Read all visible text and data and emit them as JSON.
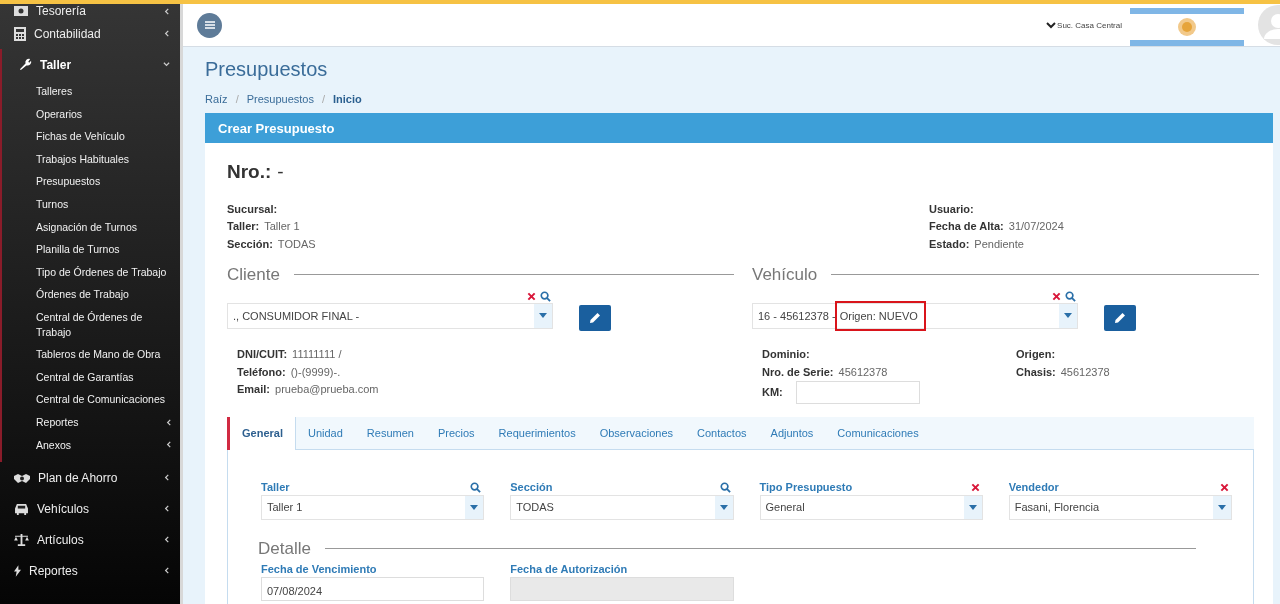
{
  "sidebar": {
    "items": [
      {
        "label": "Tesorería",
        "expanded": false
      },
      {
        "label": "Contabilidad",
        "expanded": false
      },
      {
        "label": "Taller",
        "expanded": true,
        "children": [
          {
            "label": "Talleres",
            "submenu": false
          },
          {
            "label": "Operarios",
            "submenu": false
          },
          {
            "label": "Fichas de Vehículo",
            "submenu": false
          },
          {
            "label": "Trabajos Habituales",
            "submenu": false
          },
          {
            "label": "Presupuestos",
            "submenu": false
          },
          {
            "label": "Turnos",
            "submenu": false
          },
          {
            "label": "Asignación de Turnos",
            "submenu": false
          },
          {
            "label": "Planilla de Turnos",
            "submenu": false
          },
          {
            "label": "Tipo de Órdenes de Trabajo",
            "submenu": false
          },
          {
            "label": "Órdenes de Trabajo",
            "submenu": false
          },
          {
            "label": "Central de Órdenes de Trabajo",
            "submenu": false
          },
          {
            "label": "Tableros de Mano de Obra",
            "submenu": false
          },
          {
            "label": "Central de Garantías",
            "submenu": false
          },
          {
            "label": "Central de Comunicaciones",
            "submenu": false
          },
          {
            "label": "Reportes",
            "submenu": true
          },
          {
            "label": "Anexos",
            "submenu": true
          }
        ]
      },
      {
        "label": "Plan de Ahorro",
        "expanded": false
      },
      {
        "label": "Vehículos",
        "expanded": false
      },
      {
        "label": "Artículos",
        "expanded": false
      },
      {
        "label": "Reportes",
        "expanded": false
      }
    ]
  },
  "header": {
    "branch": "Suc. Casa Central"
  },
  "page": {
    "title": "Presupuestos",
    "separator": "/",
    "breadcrumb": [
      {
        "label": "Raíz",
        "selected": false
      },
      {
        "label": "Presupuestos",
        "selected": false
      },
      {
        "label": "Inicio",
        "selected": true
      }
    ]
  },
  "panel": {
    "title": "Crear Presupuesto",
    "number_label": "Nro.:",
    "number": "-",
    "info_left": [
      {
        "label": "Sucursal:"
      },
      {
        "label": "Taller:",
        "value": "Taller 1"
      },
      {
        "label": "Sección:",
        "value": "TODAS"
      }
    ],
    "info_right": [
      {
        "label": "Usuario:"
      },
      {
        "label": "Fecha de Alta:",
        "value": "31/07/2024"
      },
      {
        "label": "Estado:",
        "value": "Pendiente"
      }
    ],
    "cliente": {
      "title": "Cliente",
      "select": [
        {
          "text": "., CONSUMIDOR FINAL -",
          "highlighted": false
        }
      ],
      "details": [
        {
          "label": "DNI/CUIT:",
          "value": "11111111 /"
        },
        {
          "label": "Teléfono:",
          "value": "()-(9999)-."
        },
        {
          "label": "Email:",
          "value": "prueba@prueba.com"
        }
      ]
    },
    "vehiculo": {
      "title": "Vehículo",
      "select": [
        {
          "text": "16 - 45612378 -",
          "highlighted": false
        },
        {
          "text": "Origen: NUEVO",
          "highlighted": true
        }
      ],
      "details_left": [
        {
          "label": "Dominio:"
        },
        {
          "label": "Nro. de Serie:",
          "value": "45612378"
        },
        {
          "label": "KM:",
          "kind": "input"
        }
      ],
      "details_right": [
        {
          "label": "Origen:"
        },
        {
          "label": "Chasis:",
          "value": "45612378"
        }
      ]
    },
    "tabs": [
      {
        "label": "General",
        "selected": true
      },
      {
        "label": "Unidad",
        "selected": false
      },
      {
        "label": "Resumen",
        "selected": false
      },
      {
        "label": "Precios",
        "selected": false
      },
      {
        "label": "Requerimientos",
        "selected": false
      },
      {
        "label": "Observaciones",
        "selected": false
      },
      {
        "label": "Contactos",
        "selected": false
      },
      {
        "label": "Adjuntos",
        "selected": false
      },
      {
        "label": "Comunicaciones",
        "selected": false
      }
    ],
    "fields": [
      {
        "label": "Taller",
        "value": "Taller 1",
        "kind": "search"
      },
      {
        "label": "Sección",
        "value": "TODAS",
        "kind": "search"
      },
      {
        "label": "Tipo Presupuesto",
        "value": "General",
        "kind": "clear"
      },
      {
        "label": "Vendedor",
        "value": "Fasani, Florencia",
        "kind": "clear"
      }
    ],
    "detalle": {
      "title": "Detalle",
      "fields": [
        {
          "label": "Fecha de Vencimiento",
          "value": "07/08/2024",
          "disabled": false
        },
        {
          "label": "Fecha de Autorización",
          "disabled": true
        }
      ]
    }
  }
}
